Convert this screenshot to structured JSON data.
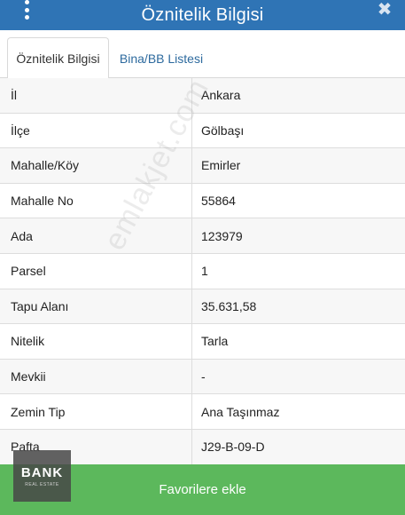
{
  "header": {
    "title": "Öznitelik Bilgisi",
    "menu_icon": "vertical-dots-icon",
    "close_icon": "close-icon",
    "close_glyph": "✖"
  },
  "tabs": [
    {
      "label": "Öznitelik Bilgisi",
      "active": true
    },
    {
      "label": "Bina/BB Listesi",
      "active": false
    }
  ],
  "rows": [
    {
      "label": "İl",
      "value": "Ankara"
    },
    {
      "label": "İlçe",
      "value": "Gölbaşı"
    },
    {
      "label": "Mahalle/Köy",
      "value": "Emirler"
    },
    {
      "label": "Mahalle No",
      "value": "55864"
    },
    {
      "label": "Ada",
      "value": "123979"
    },
    {
      "label": "Parsel",
      "value": "1"
    },
    {
      "label": "Tapu Alanı",
      "value": "35.631,58"
    },
    {
      "label": "Nitelik",
      "value": "Tarla"
    },
    {
      "label": "Mevkii",
      "value": "-"
    },
    {
      "label": "Zemin Tip",
      "value": "Ana Taşınmaz"
    },
    {
      "label": "Pafta",
      "value": "J29-B-09-D"
    }
  ],
  "watermark": "emlakjet.com",
  "favorite_button": {
    "label": "Favorilere ekle"
  },
  "logo": {
    "text": "BANK",
    "subtext": "REAL ESTATE"
  },
  "colors": {
    "header": "#2f74b5",
    "tab_link": "#2d6a9e",
    "button": "#5cb85c"
  }
}
